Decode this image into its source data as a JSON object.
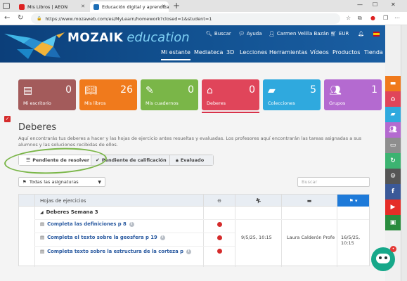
{
  "browser": {
    "tabs": [
      {
        "title": "Mis Libros | AEON"
      },
      {
        "title": "Educación digital y aprendizaje It"
      }
    ],
    "url": "https://www.mozaweb.com/es/MyLearn/homework?closed=1&student=1"
  },
  "header": {
    "brand_main": "MOZAIK",
    "brand_sub": "education",
    "search_label": "Buscar",
    "help_label": "Ayuda",
    "user_name": "Carmen Velilla Bazán",
    "currency": "EUR",
    "nav": [
      "Mi estante",
      "Mediateca",
      "3D",
      "Lecciones",
      "Herramientas",
      "Vídeos",
      "Productos",
      "Tienda"
    ]
  },
  "cards": [
    {
      "label": "Mi escritorio",
      "count": "0",
      "color": "#a35b5b",
      "icon": "desk-icon"
    },
    {
      "label": "Mis libros",
      "count": "26",
      "color": "#f07a1c",
      "icon": "books-icon"
    },
    {
      "label": "Mis cuadernos",
      "count": "0",
      "color": "#7ab648",
      "icon": "notebook-icon"
    },
    {
      "label": "Deberes",
      "count": "0",
      "color": "#e0455a",
      "icon": "homework-icon"
    },
    {
      "label": "Colecciones",
      "count": "5",
      "color": "#2fa9de",
      "icon": "folder-icon"
    },
    {
      "label": "Grupos",
      "count": "1",
      "color": "#b46ad0",
      "icon": "group-icon"
    }
  ],
  "page": {
    "title": "Deberes",
    "description": "Aquí encontrarás tus deberes a hacer y las hojas de ejercicio antes resueltas y evaluadas. Los profesores aquí encontrarán las tareas asignadas a sus alumnos y las soluciones recibidas de ellos."
  },
  "status_tabs": [
    "Pendiente de resolver",
    "Pendiente de calificación",
    "Evaluado"
  ],
  "filter": {
    "subject_value": "Todas las asignaturas",
    "search_placeholder": "Buscar"
  },
  "table": {
    "col_sheets": "Hojas de ejercicios",
    "group_title": "Deberes Semana 3",
    "exercises": [
      "Completa las definiciones p 8",
      "Completa el texto sobre la geosfera p 19",
      "Completa texto sobre la estructura de la corteza p"
    ],
    "date_assigned": "9/5/25, 10:15",
    "teacher": "Laura Calderón Profe",
    "date_due": "16/5/25, 10:15"
  },
  "sidebar_colors": [
    "#f07a1c",
    "#e0455a",
    "#2fa9de",
    "#b46ad0",
    "#8e8e8e",
    "#3cb371",
    "#555555",
    "#3b5998",
    "#e52d27",
    "#2a8c3e"
  ]
}
